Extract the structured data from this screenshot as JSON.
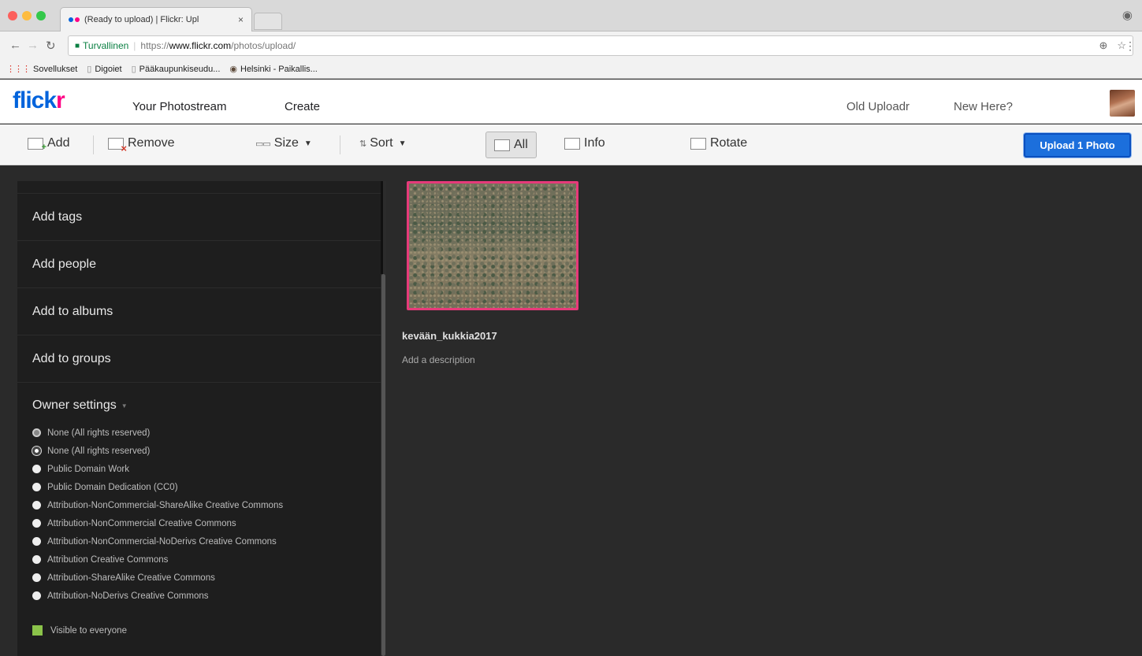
{
  "browser": {
    "tab_title": "(Ready to upload) | Flickr: Upl",
    "tab_close": "×",
    "url_secure_label": "Turvallinen",
    "url_scheme": "https://",
    "url_host": "www.flickr.com",
    "url_path": "/photos/upload/",
    "bookmarks": [
      {
        "label": "Sovellukset",
        "icon": "apps-icon"
      },
      {
        "label": "Digoiet",
        "icon": "doc-icon"
      },
      {
        "label": "Pääkaupunkiseudu...",
        "icon": "doc-icon"
      },
      {
        "label": "Helsinki - Paikallis...",
        "icon": "globe-icon"
      }
    ]
  },
  "header": {
    "logo_main": "flick",
    "logo_accent": "r",
    "nav": {
      "photostream": "Your Photostream",
      "create": "Create",
      "old_uploadr": "Old Uploadr",
      "new_here": "New Here?"
    }
  },
  "toolbar": {
    "add": "Add",
    "remove": "Remove",
    "size": "Size",
    "sort": "Sort",
    "all": "All",
    "info": "Info",
    "rotate": "Rotate",
    "upload": "Upload 1 Photo"
  },
  "sidebar": {
    "items": [
      "Add tags",
      "Add people",
      "Add to albums",
      "Add to groups"
    ],
    "owner_title": "Owner settings",
    "licenses": [
      "None (All rights reserved)",
      "None (All rights reserved)",
      "Public Domain Work",
      "Public Domain Dedication (CC0)",
      "Attribution-NonCommercial-ShareAlike Creative Commons",
      "Attribution-NonCommercial Creative Commons",
      "Attribution-NonCommercial-NoDerivs Creative Commons",
      "Attribution Creative Commons",
      "Attribution-ShareAlike Creative Commons",
      "Attribution-NoDerivs Creative Commons"
    ],
    "visibility": "Visible to everyone"
  },
  "photo": {
    "title": "kevään_kukkia2017",
    "description_placeholder": "Add a description"
  },
  "colors": {
    "flickr_blue": "#0063dc",
    "flickr_pink": "#ff0084",
    "upload_button": "#1c6fdc",
    "selected_border": "#e63a7a"
  }
}
